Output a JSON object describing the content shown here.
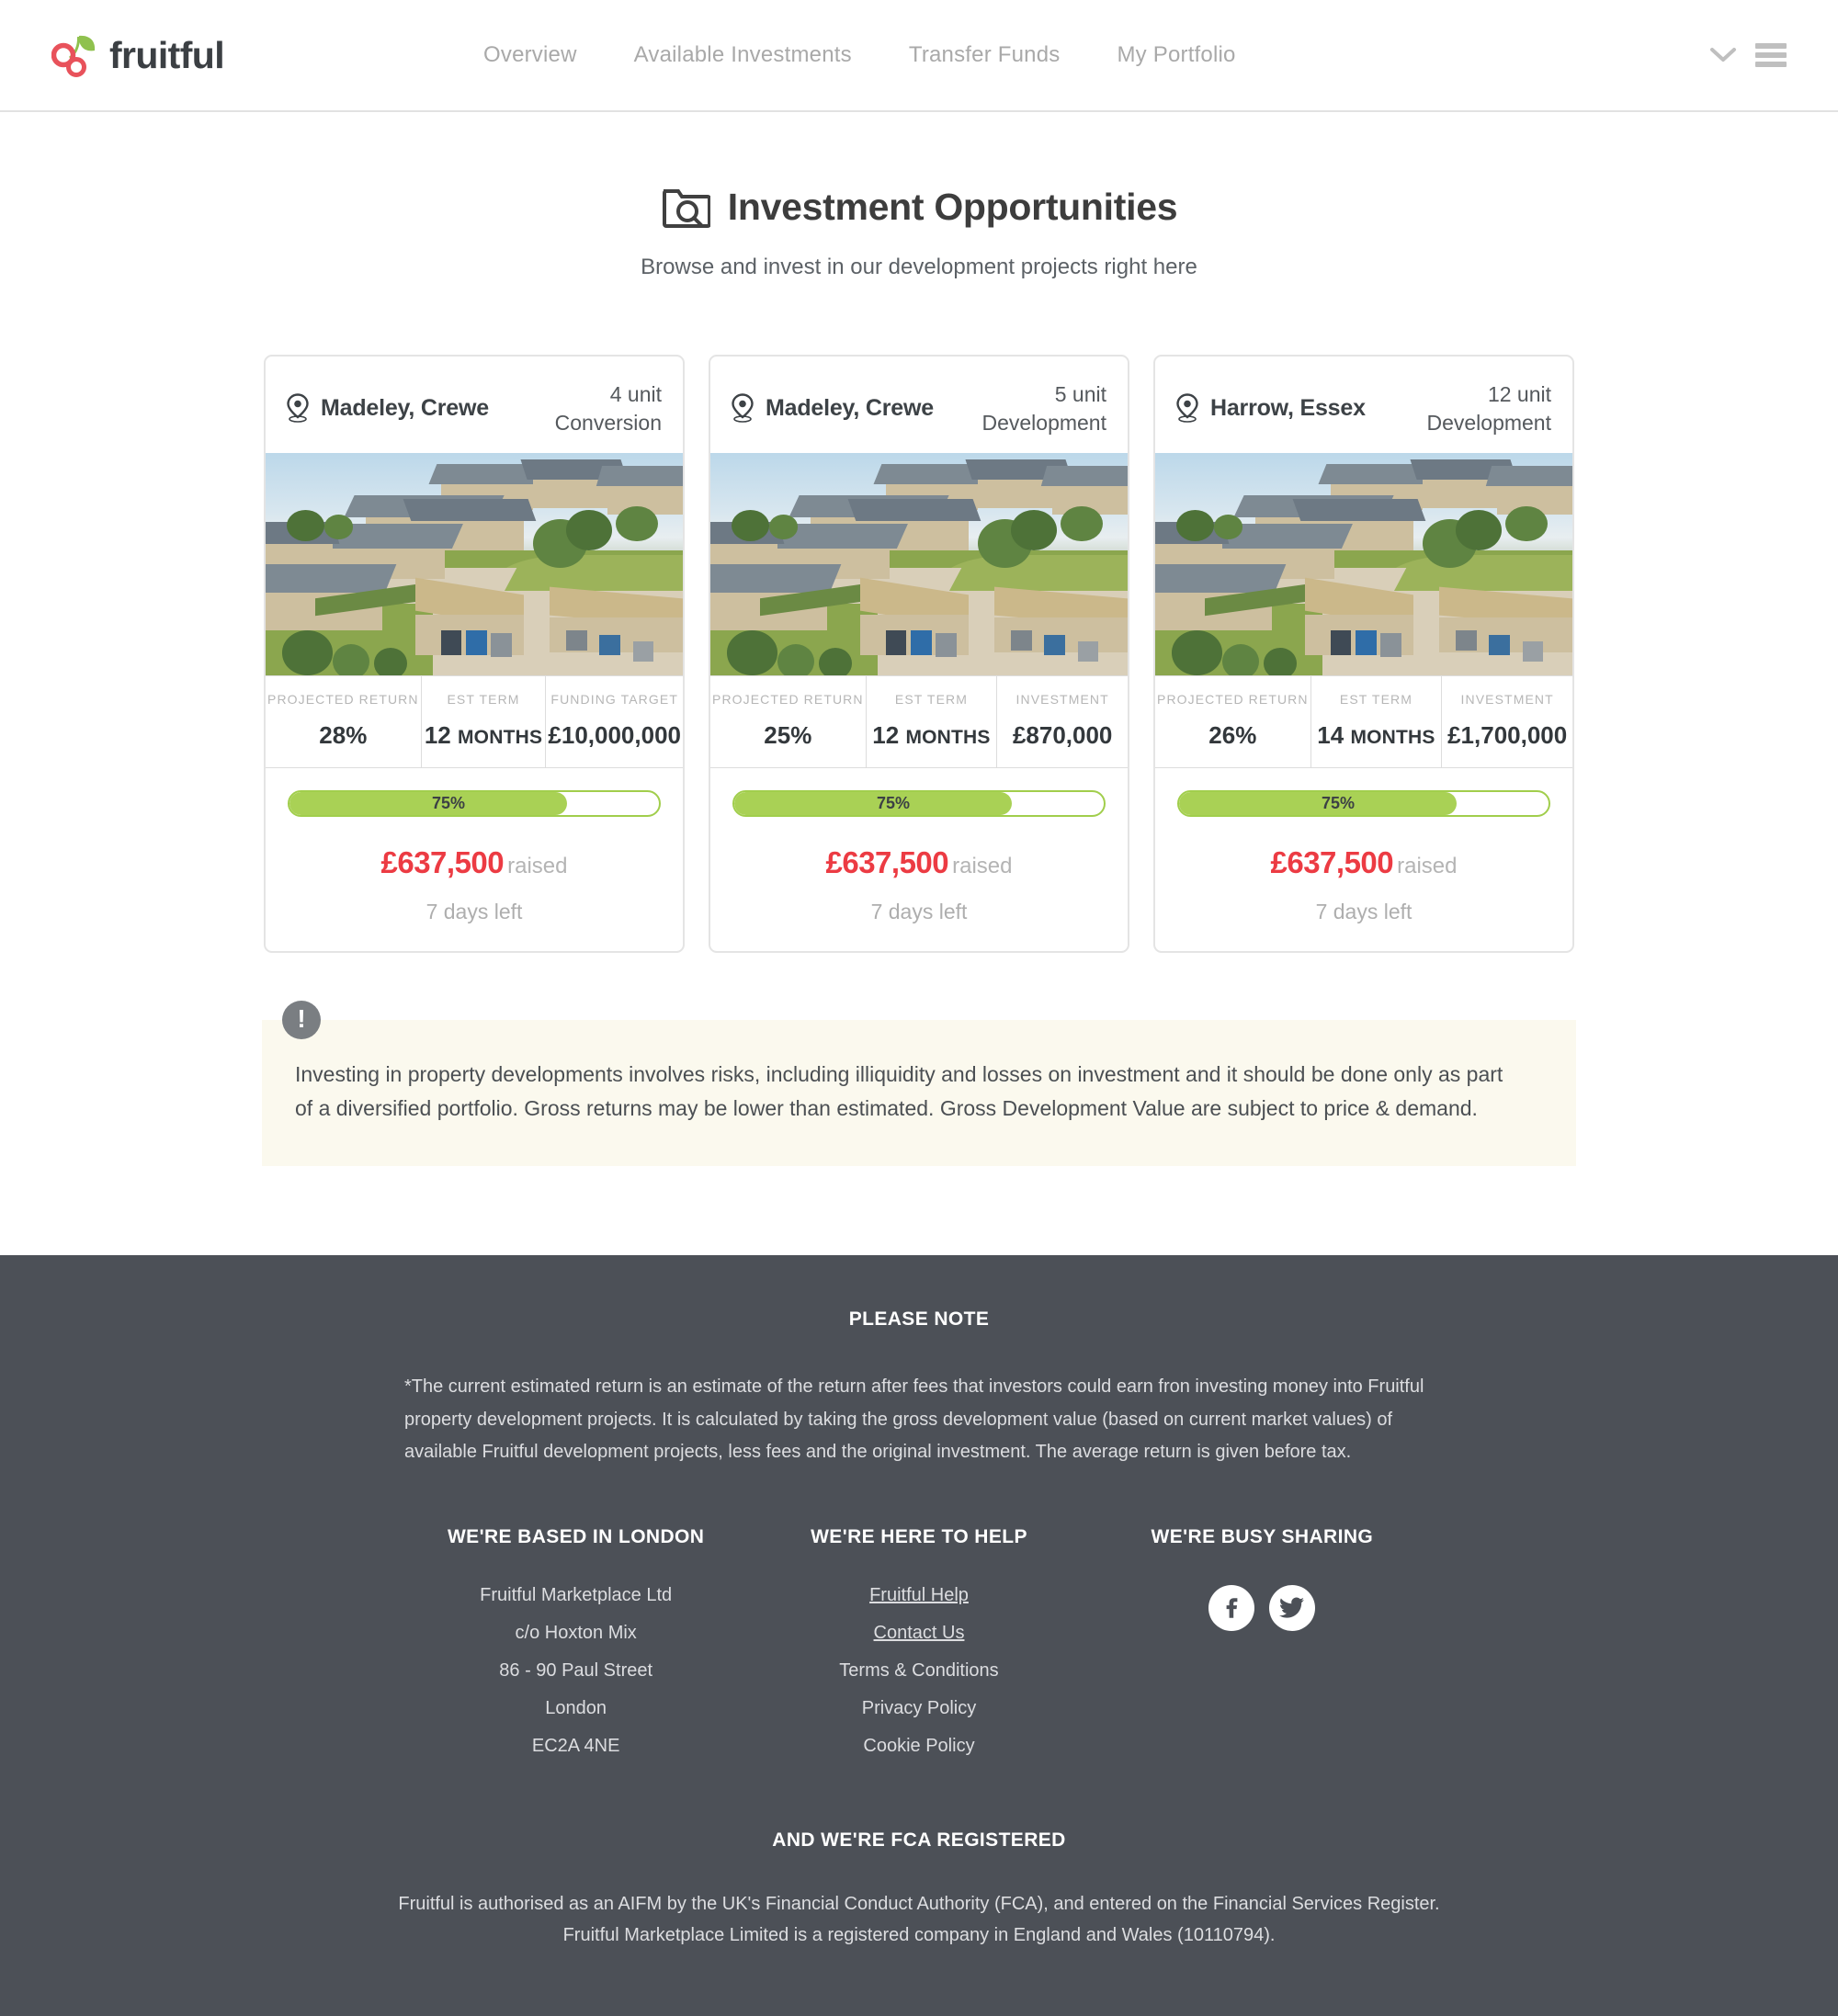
{
  "header": {
    "logo_text": "fruitful",
    "nav": [
      {
        "label": "Overview"
      },
      {
        "label": "Available Investments"
      },
      {
        "label": "Transfer Funds"
      },
      {
        "label": "My Portfolio"
      }
    ],
    "chevron_icon": "chevron-down-icon",
    "menu_icon": "hamburger-menu-icon"
  },
  "page": {
    "title": "Investment Opportunities",
    "title_icon": "folder-search-icon",
    "subtitle": "Browse and invest in our development projects right here"
  },
  "cards": [
    {
      "location": "Madeley, Crewe",
      "units": "4 unit",
      "type": "Conversion",
      "stats": [
        {
          "label": "PROJECTED RETURN",
          "value": "28%",
          "unit": ""
        },
        {
          "label": "EST TERM",
          "value": "12",
          "unit": "MONTHS"
        },
        {
          "label": "FUNDING TARGET",
          "value": "£10,000,000",
          "unit": ""
        }
      ],
      "progress_pct": "75%",
      "progress_value": 75,
      "raised_amount": "£637,500",
      "raised_label": "raised",
      "days_left": "7 days left"
    },
    {
      "location": "Madeley, Crewe",
      "units": "5 unit",
      "type": "Development",
      "stats": [
        {
          "label": "PROJECTED RETURN",
          "value": "25%",
          "unit": ""
        },
        {
          "label": "EST TERM",
          "value": "12",
          "unit": "MONTHS"
        },
        {
          "label": "INVESTMENT",
          "value": "£870,000",
          "unit": ""
        }
      ],
      "progress_pct": "75%",
      "progress_value": 75,
      "raised_amount": "£637,500",
      "raised_label": "raised",
      "days_left": "7 days left"
    },
    {
      "location": "Harrow, Essex",
      "units": "12 unit",
      "type": "Development",
      "stats": [
        {
          "label": "PROJECTED RETURN",
          "value": "26%",
          "unit": ""
        },
        {
          "label": "EST TERM",
          "value": "14",
          "unit": "MONTHS"
        },
        {
          "label": "INVESTMENT",
          "value": "£1,700,000",
          "unit": ""
        }
      ],
      "progress_pct": "75%",
      "progress_value": 75,
      "raised_amount": "£637,500",
      "raised_label": "raised",
      "days_left": "7 days left"
    }
  ],
  "notice": {
    "icon": "alert-exclamation-icon",
    "text": "Investing in property developments involves risks, including illiquidity and losses on investment and it should be done only as part of a diversified portfolio. Gross returns may be lower than estimated. Gross Development Value are subject to price & demand."
  },
  "footer": {
    "please_note_heading": "PLEASE NOTE",
    "please_note_body": "*The current estimated return is an estimate of the return after fees that investors could earn fron investing money into Fruitful property development projects. It is calculated by taking the gross development value (based on current market values) of available Fruitful development projects, less fees and the original investment. The average return is given before tax.",
    "columns": [
      {
        "heading": "WE'RE BASED IN LONDON",
        "items": [
          {
            "text": "Fruitful Marketplace Ltd",
            "link": false
          },
          {
            "text": "c/o Hoxton Mix",
            "link": false
          },
          {
            "text": "86 - 90 Paul Street",
            "link": false
          },
          {
            "text": "London",
            "link": false
          },
          {
            "text": "EC2A 4NE",
            "link": false
          }
        ]
      },
      {
        "heading": "WE'RE HERE TO HELP",
        "items": [
          {
            "text": "Fruitful Help",
            "link": true
          },
          {
            "text": "Contact Us",
            "link": true
          },
          {
            "text": "Terms & Conditions",
            "link": false
          },
          {
            "text": "Privacy Policy",
            "link": false
          },
          {
            "text": "Cookie Policy",
            "link": false
          }
        ]
      },
      {
        "heading": "WE'RE BUSY SHARING",
        "socials": [
          {
            "name": "facebook-icon"
          },
          {
            "name": "twitter-icon"
          }
        ]
      }
    ],
    "fca_heading": "AND WE'RE FCA REGISTERED",
    "fca_line_1": "Fruitful is authorised as an AIFM by the UK's Financial Conduct Authority (FCA), and entered on the Financial Services Register.",
    "fca_line_2": "Fruitful Marketplace Limited is a registered company in England and Wales (10110794)."
  },
  "colors": {
    "brand_red": "#e8525b",
    "brand_green": "#8fc14e",
    "progress_green": "#a9d155",
    "raised_red": "#ec3b43",
    "footer_bg": "#4c5057",
    "notice_bg": "#fbf9ee",
    "text_dark": "#3d4246",
    "text_muted": "#a9a9a9"
  }
}
